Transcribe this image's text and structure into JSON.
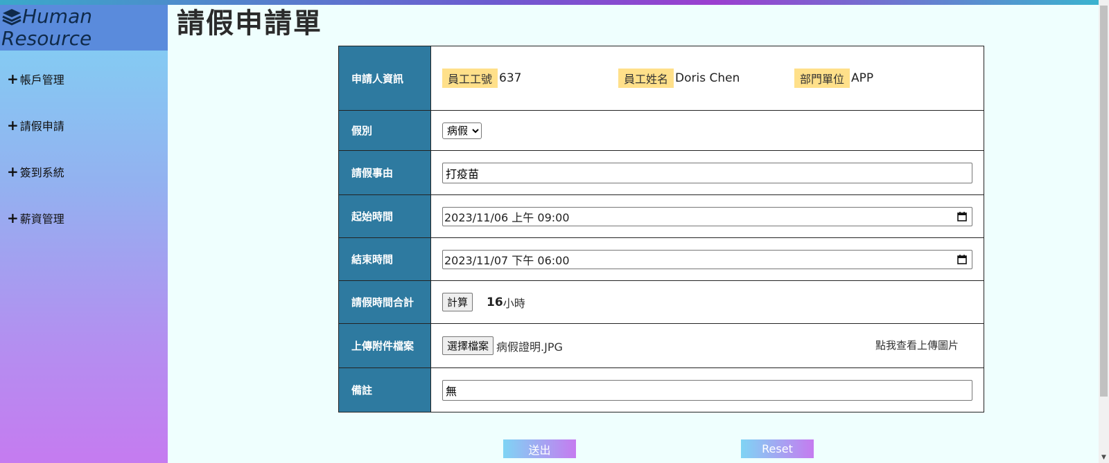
{
  "brand": {
    "line1": "Human",
    "line2": "Resource"
  },
  "sidebar": {
    "items": [
      {
        "label": "帳戶管理"
      },
      {
        "label": "請假申請"
      },
      {
        "label": "簽到系統"
      },
      {
        "label": "薪資管理"
      }
    ]
  },
  "page": {
    "title": "請假申請單"
  },
  "form": {
    "applicant": {
      "label": "申請人資訊",
      "emp_id_tag": "員工工號",
      "emp_id": "637",
      "emp_name_tag": "員工姓名",
      "emp_name": "Doris Chen",
      "dept_tag": "部門單位",
      "dept": "APP"
    },
    "leave_type": {
      "label": "假別",
      "selected": "病假"
    },
    "reason": {
      "label": "請假事由",
      "value": "打疫苗"
    },
    "start": {
      "label": "起始時間",
      "value": "2023/11/06 上午 09:00"
    },
    "end": {
      "label": "結束時間",
      "value": "2023/11/07 下午 06:00"
    },
    "total": {
      "label": "請假時間合計",
      "button": "計算",
      "hours": "16",
      "unit": "小時"
    },
    "upload": {
      "label": "上傳附件檔案",
      "button": "選擇檔案",
      "filename": "病假證明.JPG",
      "view_link": "點我查看上傳圖片"
    },
    "remark": {
      "label": "備註",
      "value": "無"
    }
  },
  "actions": {
    "submit": "送出",
    "reset": "Reset"
  }
}
